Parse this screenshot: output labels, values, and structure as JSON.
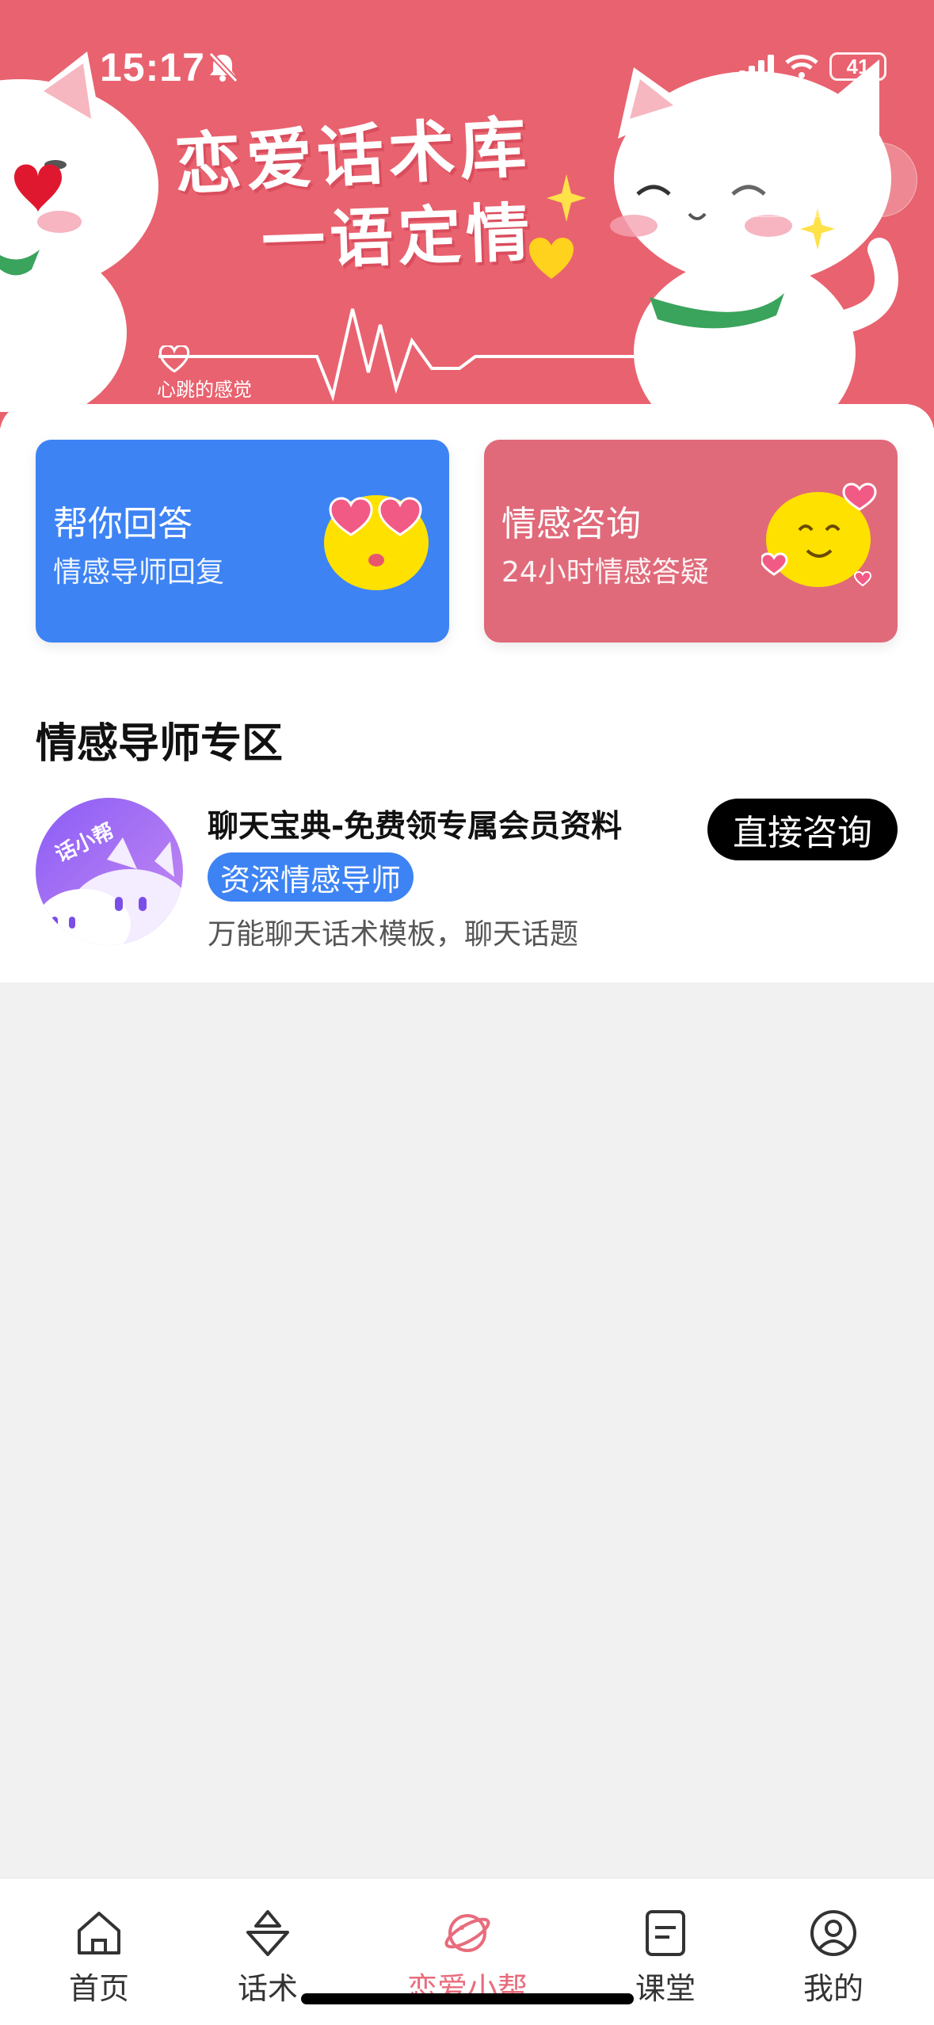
{
  "status_bar": {
    "time": "15:17",
    "battery": "41"
  },
  "banner": {
    "title_line1": "恋爱话术库",
    "title_line2": "一语定情",
    "caption": "心跳的感觉"
  },
  "cards": [
    {
      "title": "帮你回答",
      "subtitle": "情感导师回复",
      "color": "#3d83f4"
    },
    {
      "title": "情感咨询",
      "subtitle": "24小时情感答疑",
      "color": "#e06a7a"
    }
  ],
  "section": {
    "title": "情感导师专区"
  },
  "mentor": {
    "avatar_text": "话小帮",
    "name": "聊天宝典-免费领专属会员资料",
    "tag": "资深情感导师",
    "description": "万能聊天话术模板，聊天话题",
    "button": "直接咨询"
  },
  "tabbar": {
    "active_color": "#e86c7c",
    "items": [
      {
        "label": "首页",
        "icon": "home-icon"
      },
      {
        "label": "话术",
        "icon": "chat-script-icon"
      },
      {
        "label": "恋爱小帮",
        "icon": "planet-icon",
        "active": true
      },
      {
        "label": "课堂",
        "icon": "document-icon"
      },
      {
        "label": "我的",
        "icon": "profile-icon"
      }
    ]
  }
}
